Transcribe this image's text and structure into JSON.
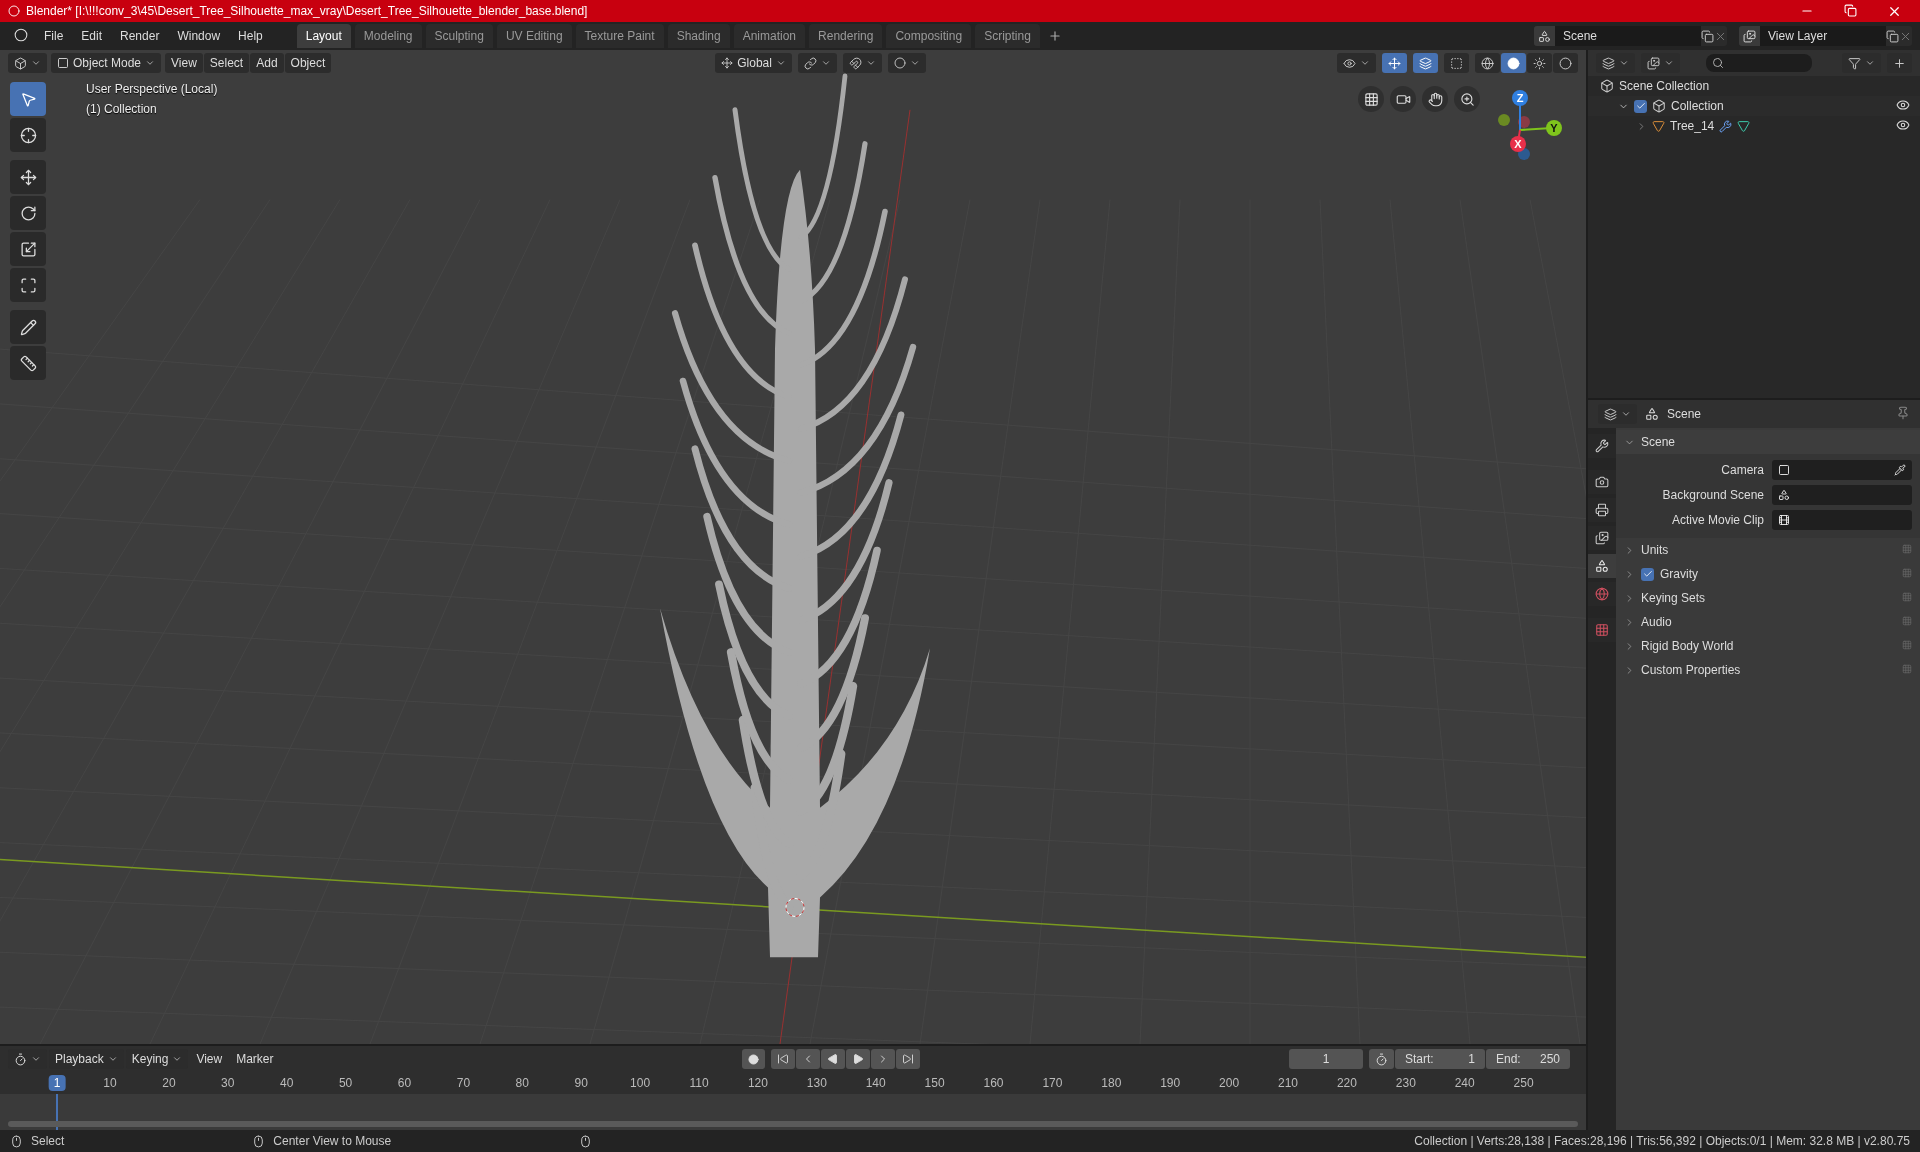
{
  "title_bar": {
    "title": "Blender* [I:\\!!!conv_3\\45\\Desert_Tree_Silhouette_max_vray\\Desert_Tree_Silhouette_blender_base.blend]"
  },
  "menu": [
    "File",
    "Edit",
    "Render",
    "Window",
    "Help"
  ],
  "workspaces": [
    {
      "label": "Layout",
      "selected": true
    },
    {
      "label": "Modeling",
      "selected": false
    },
    {
      "label": "Sculpting",
      "selected": false
    },
    {
      "label": "UV Editing",
      "selected": false
    },
    {
      "label": "Texture Paint",
      "selected": false
    },
    {
      "label": "Shading",
      "selected": false
    },
    {
      "label": "Animation",
      "selected": false
    },
    {
      "label": "Rendering",
      "selected": false
    },
    {
      "label": "Compositing",
      "selected": false
    },
    {
      "label": "Scripting",
      "selected": false
    }
  ],
  "scene_selector": {
    "value": "Scene"
  },
  "view_layer_selector": {
    "value": "View Layer"
  },
  "viewport": {
    "mode": "Object Mode",
    "menus": [
      "View",
      "Select",
      "Add",
      "Object"
    ],
    "orientation": "Global",
    "info": [
      "User Perspective (Local)",
      "(1) Collection"
    ],
    "tools": [
      {
        "kind": "select",
        "selected": true
      },
      {
        "kind": "cursor",
        "selected": false
      },
      {
        "kind": "move",
        "selected": false
      },
      {
        "kind": "rotate",
        "selected": false
      },
      {
        "kind": "scale",
        "selected": false
      },
      {
        "kind": "transform",
        "selected": false
      },
      {
        "kind": "annotate",
        "selected": false
      },
      {
        "kind": "measure",
        "selected": false
      }
    ],
    "axes": [
      {
        "label": "Z",
        "color": "#2f7fe0"
      },
      {
        "label": "Y",
        "color": "#7fc41c"
      },
      {
        "label": "X",
        "color": "#e8304a"
      }
    ]
  },
  "outliner": {
    "items": [
      {
        "label": "Scene Collection",
        "children": [
          {
            "label": "Collection",
            "checked": true,
            "expanded": true,
            "children": [
              {
                "label": "Tree_14"
              }
            ]
          }
        ]
      }
    ]
  },
  "properties": {
    "title": "Scene",
    "tabs": [
      {
        "kind": "tool",
        "selected": false
      },
      {
        "kind": "render",
        "selected": false
      },
      {
        "kind": "output",
        "selected": false
      },
      {
        "kind": "view_layer",
        "selected": false
      },
      {
        "kind": "scene",
        "selected": true
      },
      {
        "kind": "world",
        "selected": false
      },
      {
        "kind": "texture",
        "selected": false
      }
    ],
    "panel": {
      "title": "Scene",
      "expanded": true,
      "fields": [
        "Camera",
        "Background Scene",
        "Active Movie Clip"
      ]
    },
    "sections": [
      {
        "label": "Units"
      },
      {
        "label": "Gravity",
        "checked": true
      },
      {
        "label": "Keying Sets"
      },
      {
        "label": "Audio"
      },
      {
        "label": "Rigid Body World"
      },
      {
        "label": "Custom Properties"
      }
    ]
  },
  "timeline": {
    "menus": [
      "Playback",
      "Keying",
      "View",
      "Marker"
    ],
    "current_frame": "1",
    "start_label": "Start:",
    "start": "1",
    "end_label": "End:",
    "end": "250",
    "ruler": [
      {
        "label": "1",
        "selected": true
      },
      {
        "label": "10",
        "selected": false
      },
      {
        "label": "20",
        "selected": false
      },
      {
        "label": "30",
        "selected": false
      },
      {
        "label": "40",
        "selected": false
      },
      {
        "label": "50",
        "selected": false
      },
      {
        "label": "60",
        "selected": false
      },
      {
        "label": "70",
        "selected": false
      },
      {
        "label": "80",
        "selected": false
      },
      {
        "label": "90",
        "selected": false
      },
      {
        "label": "100",
        "selected": false
      },
      {
        "label": "110",
        "selected": false
      },
      {
        "label": "120",
        "selected": false
      },
      {
        "label": "130",
        "selected": false
      },
      {
        "label": "140",
        "selected": false
      },
      {
        "label": "150",
        "selected": false
      },
      {
        "label": "160",
        "selected": false
      },
      {
        "label": "170",
        "selected": false
      },
      {
        "label": "180",
        "selected": false
      },
      {
        "label": "190",
        "selected": false
      },
      {
        "label": "200",
        "selected": false
      },
      {
        "label": "210",
        "selected": false
      },
      {
        "label": "220",
        "selected": false
      },
      {
        "label": "230",
        "selected": false
      },
      {
        "label": "240",
        "selected": false
      },
      {
        "label": "250",
        "selected": false
      }
    ]
  },
  "status_bar": {
    "hints": [
      "Select",
      "Center View to Mouse"
    ],
    "stats": "Collection | Verts:28,138 | Faces:28,196 | Tris:56,392 | Objects:0/1 | Mem: 32.8 MB | v2.80.75"
  }
}
